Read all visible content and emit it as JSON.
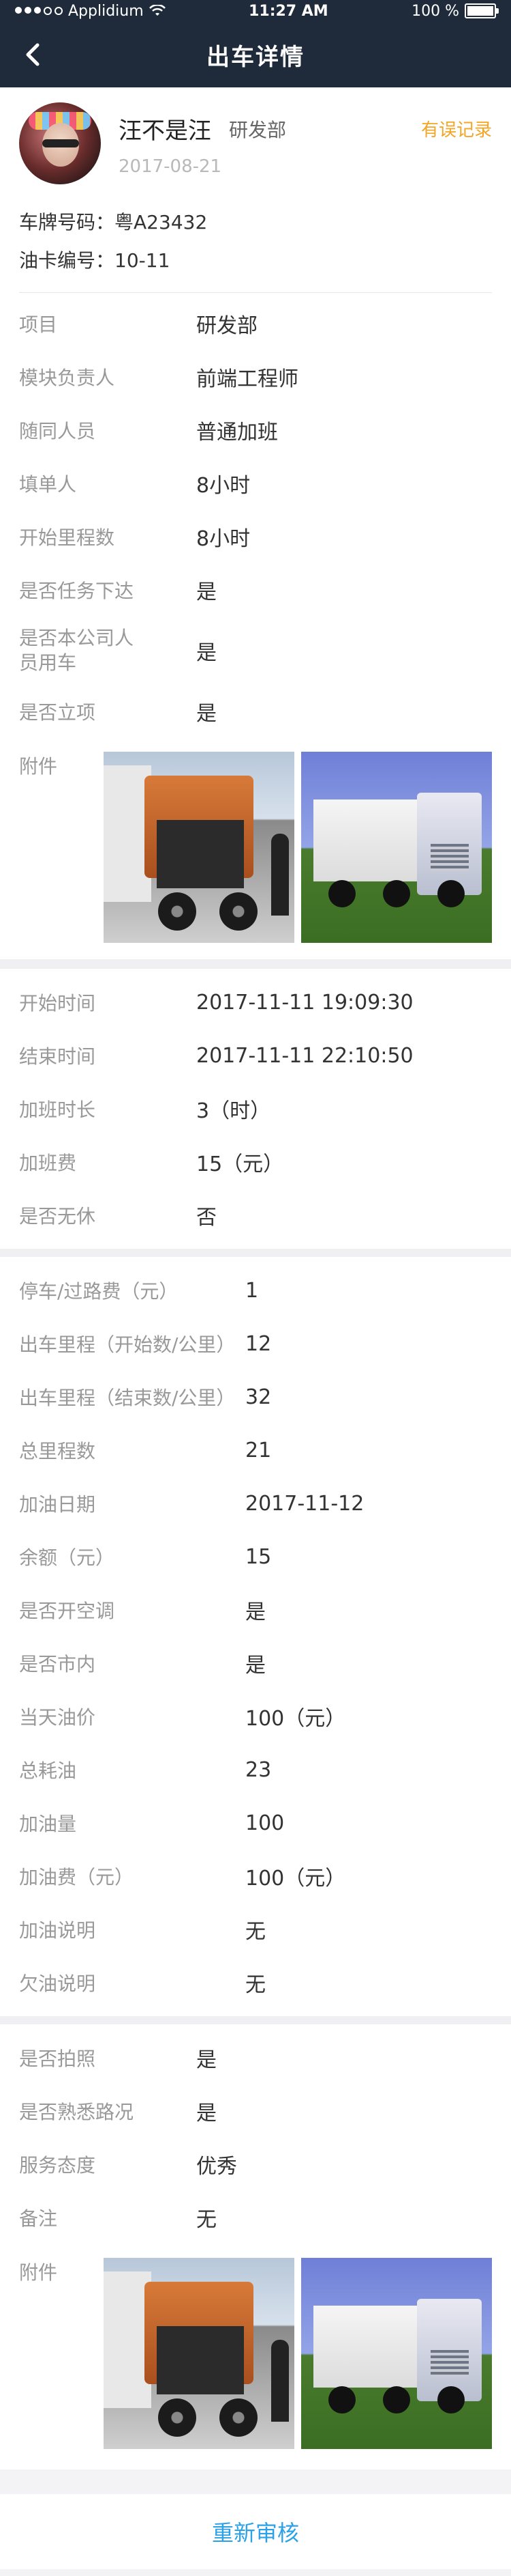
{
  "status_bar": {
    "carrier": "Applidium",
    "time": "11:27 AM",
    "battery": "100 %"
  },
  "nav": {
    "title": "出车详情"
  },
  "profile": {
    "name": "汪不是汪",
    "department": "研发部",
    "date": "2017-08-21",
    "error_link": "有误记录"
  },
  "vehicle": {
    "plate_label": "车牌号码",
    "plate_value": "粤A23432",
    "fuel_card_label": "油卡编号",
    "fuel_card_value": "10-11"
  },
  "section1": {
    "rows": [
      {
        "label": "项目",
        "value": "研发部"
      },
      {
        "label": "模块负责人",
        "value": "前端工程师"
      },
      {
        "label": "随同人员",
        "value": "普通加班"
      },
      {
        "label": "填单人",
        "value": "8小时"
      },
      {
        "label": "开始里程数",
        "value": "8小时"
      },
      {
        "label": "是否任务下达",
        "value": "是"
      },
      {
        "label_line1": "是否本公司人",
        "label_line2": "员用车",
        "value": "是"
      },
      {
        "label": "是否立项",
        "value": "是"
      }
    ],
    "attach_label": "附件"
  },
  "section2": {
    "rows": [
      {
        "label": "开始时间",
        "value": "2017-11-11 19:09:30"
      },
      {
        "label": "结束时间",
        "value": "2017-11-11 22:10:50"
      },
      {
        "label": "加班时长",
        "value": "3（时）"
      },
      {
        "label": "加班费",
        "value": "15（元）"
      },
      {
        "label": "是否无休",
        "value": "否"
      }
    ]
  },
  "section3": {
    "rows": [
      {
        "label": "停车/过路费（元）",
        "value": "1"
      },
      {
        "label": "出车里程（开始数/公里）",
        "value": "12"
      },
      {
        "label": "出车里程（结束数/公里）",
        "value": "32"
      },
      {
        "label": "总里程数",
        "value": "21"
      },
      {
        "label": "加油日期",
        "value": "2017-11-12"
      },
      {
        "label": "余额（元）",
        "value": "15"
      },
      {
        "label": "是否开空调",
        "value": "是"
      },
      {
        "label": "是否市内",
        "value": "是"
      },
      {
        "label": "当天油价",
        "value": "100（元）"
      },
      {
        "label": "总耗油",
        "value": "23"
      },
      {
        "label": "加油量",
        "value": "100"
      },
      {
        "label": "加油费（元）",
        "value": "100（元）"
      },
      {
        "label": "加油说明",
        "value": "无"
      },
      {
        "label": "欠油说明",
        "value": "无"
      }
    ]
  },
  "section4": {
    "rows": [
      {
        "label": "是否拍照",
        "value": "是"
      },
      {
        "label": "是否熟悉路况",
        "value": "是"
      },
      {
        "label": "服务态度",
        "value": "优秀"
      },
      {
        "label": "备注",
        "value": "无"
      }
    ],
    "attach_label": "附件"
  },
  "footer": {
    "button": "重新审核"
  },
  "colors": {
    "nav_bg": "#1f2b3a",
    "accent_link": "#f5a524",
    "footer_button": "#2ba2e8",
    "label": "#999999",
    "value": "#333333"
  }
}
